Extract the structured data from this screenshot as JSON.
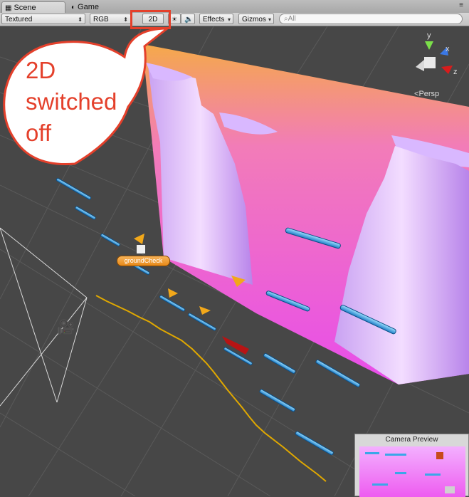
{
  "tabs": {
    "scene": "Scene",
    "game": "Game"
  },
  "toolbar": {
    "draw_mode": "Textured",
    "render_mode": "RGB",
    "toggle_2d": "2D",
    "effects": "Effects",
    "gizmos": "Gizmos",
    "search_placeholder": "All"
  },
  "callout": {
    "text": "2D switched off",
    "color": "#e4402b"
  },
  "scene": {
    "ground_check_label": "groundCheck",
    "projection_label": "Persp",
    "gizmo_axes": {
      "x": "x",
      "y": "y",
      "z": "z"
    }
  },
  "camera_preview": {
    "title": "Camera Preview"
  },
  "colors": {
    "background": "#474747",
    "sky_top": "#f5a94a",
    "sky_bottom": "#e84dea",
    "highlight": "#e4402b",
    "platform": "#3aa7e8"
  }
}
